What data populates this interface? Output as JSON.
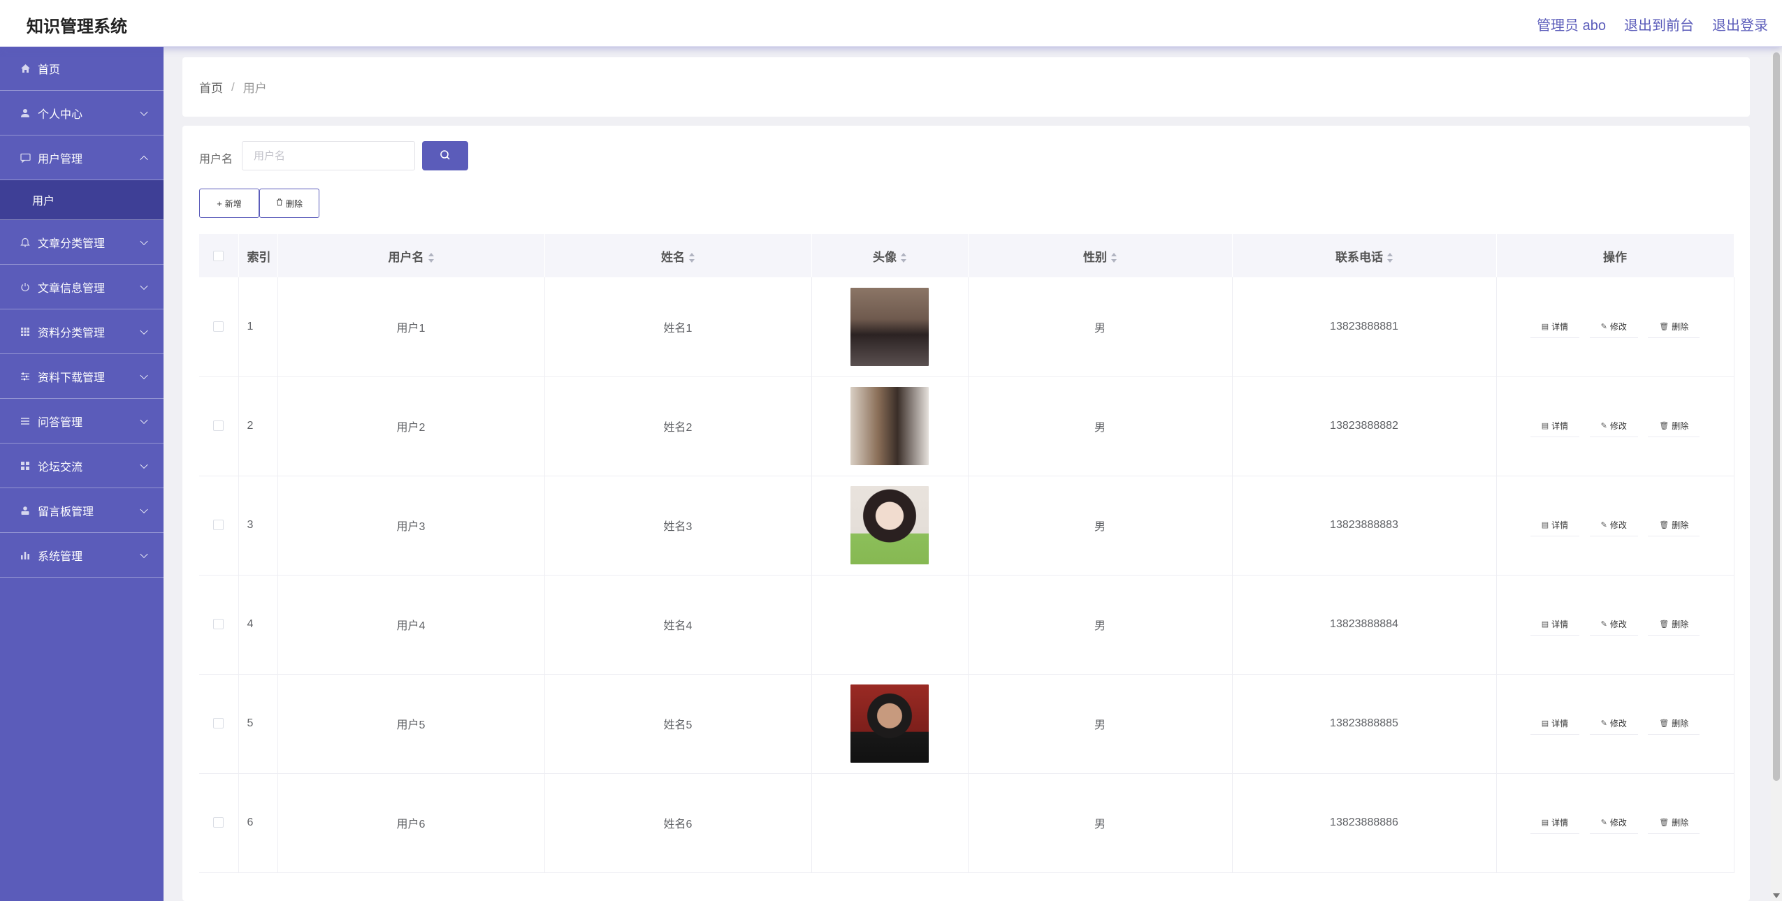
{
  "header": {
    "title": "知识管理系统",
    "user_label": "管理员 abo",
    "exit_front_label": "退出到前台",
    "logout_label": "退出登录"
  },
  "sidebar": {
    "items": [
      {
        "label": "首页",
        "icon": "home-icon"
      },
      {
        "label": "个人中心",
        "icon": "user-icon"
      },
      {
        "label": "用户管理",
        "icon": "chat-icon",
        "expanded": true
      },
      {
        "label": "用户",
        "sub": true,
        "active": true
      },
      {
        "label": "文章分类管理",
        "icon": "bell-icon"
      },
      {
        "label": "文章信息管理",
        "icon": "power-icon"
      },
      {
        "label": "资料分类管理",
        "icon": "grid-icon"
      },
      {
        "label": "资料下载管理",
        "icon": "sliders-icon"
      },
      {
        "label": "问答管理",
        "icon": "list-icon"
      },
      {
        "label": "论坛交流",
        "icon": "apps-icon"
      },
      {
        "label": "留言板管理",
        "icon": "person-icon"
      },
      {
        "label": "系统管理",
        "icon": "chart-icon"
      }
    ]
  },
  "breadcrumb": {
    "home": "首页",
    "separator": "/",
    "current": "用户"
  },
  "search": {
    "label": "用户名",
    "placeholder": "用户名"
  },
  "actions": {
    "add_label": "新增",
    "delete_label": "删除"
  },
  "table": {
    "columns": [
      "索引",
      "用户名",
      "姓名",
      "头像",
      "性别",
      "联系电话",
      "操作"
    ],
    "rows": [
      {
        "index": "1",
        "username": "用户1",
        "name": "姓名1",
        "avatar": "photo-woman-black-top",
        "gender": "男",
        "phone": "13823888881"
      },
      {
        "index": "2",
        "username": "用户2",
        "name": "姓名2",
        "avatar": "photo-person-painting",
        "gender": "男",
        "phone": "13823888882"
      },
      {
        "index": "3",
        "username": "用户3",
        "name": "姓名3",
        "avatar": "photo-girl-green-sweater",
        "gender": "男",
        "phone": "13823888883"
      },
      {
        "index": "4",
        "username": "用户4",
        "name": "姓名4",
        "avatar": "",
        "gender": "男",
        "phone": "13823888884"
      },
      {
        "index": "5",
        "username": "用户5",
        "name": "姓名5",
        "avatar": "photo-man-red-background",
        "gender": "男",
        "phone": "13823888885"
      },
      {
        "index": "6",
        "username": "用户6",
        "name": "姓名6",
        "avatar": "",
        "gender": "男",
        "phone": "13823888886"
      }
    ],
    "row_actions": {
      "detail": "详情",
      "edit": "修改",
      "delete": "删除"
    }
  },
  "colors": {
    "accent": "#5b5cba",
    "submenu_active": "#3e3f96",
    "header_bg": "#ffffff",
    "page_bg": "#f0f0f4"
  }
}
